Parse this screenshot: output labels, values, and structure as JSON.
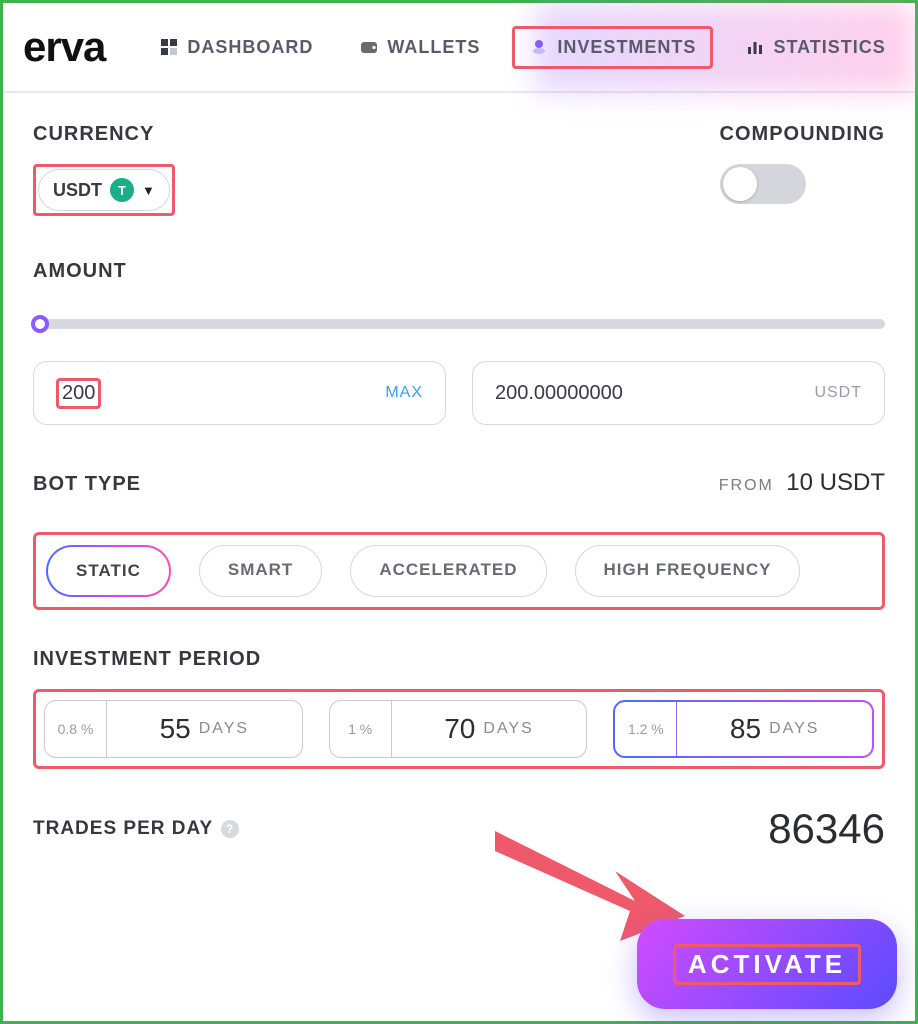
{
  "logo_fragment": "erva",
  "nav": {
    "dashboard": "DASHBOARD",
    "wallets": "WALLETS",
    "investments": "INVESTMENTS",
    "statistics": "STATISTICS"
  },
  "labels": {
    "currency": "CURRENCY",
    "compounding": "COMPOUNDING",
    "amount": "AMOUNT",
    "bot_type": "BOT TYPE",
    "investment_period": "INVESTMENT PERIOD",
    "trades_per_day": "TRADES PER DAY",
    "from": "FROM",
    "max": "MAX",
    "days": "DAYS"
  },
  "currency": {
    "selected": "USDT",
    "badge": "T"
  },
  "compounding_on": false,
  "amount": {
    "input_value": "200",
    "display_value": "200.00000000",
    "display_suffix": "USDT"
  },
  "bot": {
    "from_value": "10 USDT",
    "options": [
      "STATIC",
      "SMART",
      "ACCELERATED",
      "HIGH FREQUENCY"
    ],
    "selected_index": 0
  },
  "periods": [
    {
      "pct": "0.8 %",
      "days": "55"
    },
    {
      "pct": "1 %",
      "days": "70"
    },
    {
      "pct": "1.2 %",
      "days": "85"
    }
  ],
  "period_selected_index": 2,
  "trades_per_day": "86346",
  "activate": "ACTIVATE"
}
